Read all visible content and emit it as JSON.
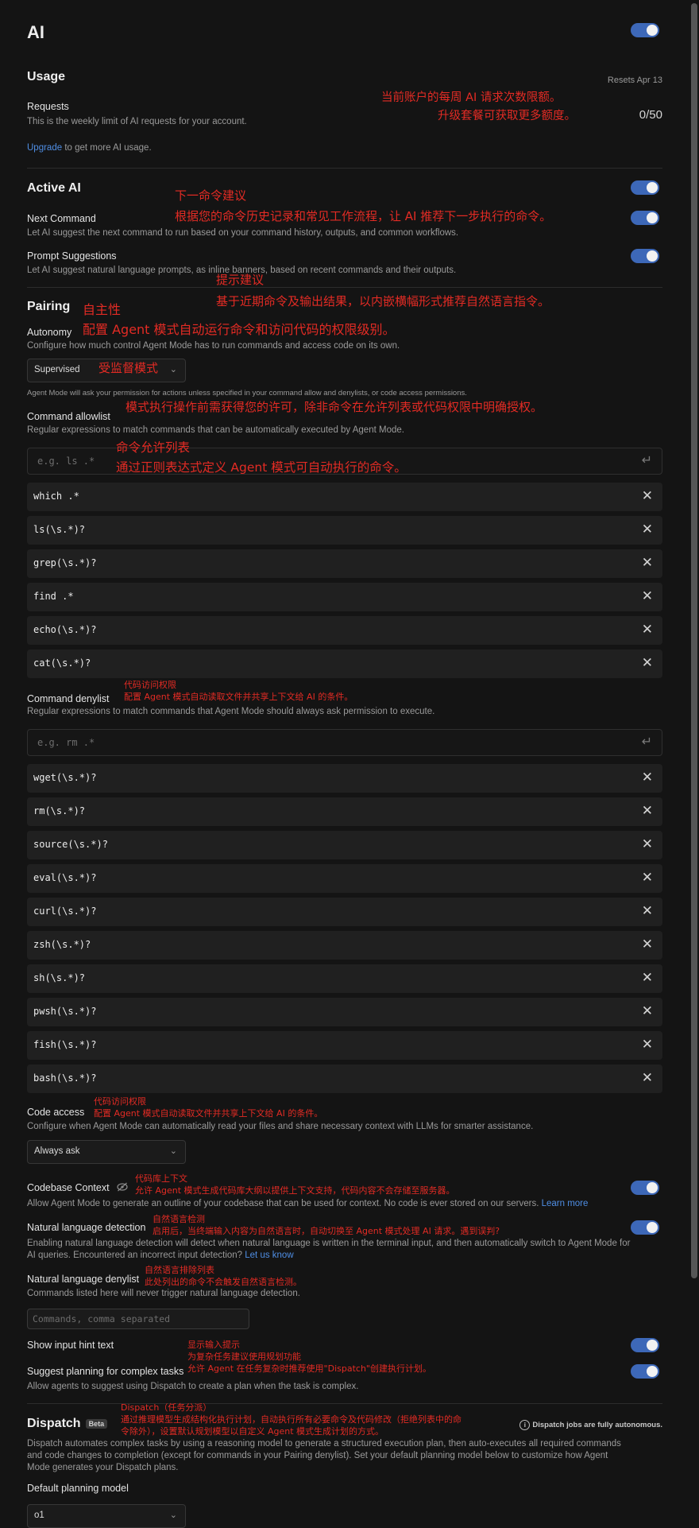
{
  "page": {
    "title": "AI"
  },
  "usage": {
    "heading": "Usage",
    "resets": "Resets Apr 13",
    "requests_label": "Requests",
    "requests_desc": "This is the weekly limit of AI requests for your account.",
    "count": "0/50",
    "upgrade_link": "Upgrade",
    "upgrade_rest": " to get more AI usage."
  },
  "active_ai": {
    "heading": "Active AI",
    "next_command_label": "Next Command",
    "next_command_desc": "Let AI suggest the next command to run based on your command history, outputs, and common workflows.",
    "prompt_suggestions_label": "Prompt Suggestions",
    "prompt_suggestions_desc": "Let AI suggest natural language prompts, as inline banners, based on recent commands and their outputs."
  },
  "pairing": {
    "heading": "Pairing",
    "autonomy_label": "Autonomy",
    "autonomy_desc": "Configure how much control Agent Mode has to run commands and access code on its own.",
    "autonomy_value": "Supervised",
    "autonomy_note": "Agent Mode will ask your permission for actions unless specified in your command allow and denylists, or code access permissions.",
    "allowlist_label": "Command allowlist",
    "allowlist_desc": "Regular expressions to match commands that can be automatically executed by Agent Mode.",
    "allowlist_placeholder": "e.g. ls .*",
    "allowlist": [
      "which .*",
      "ls(\\s.*)?",
      "grep(\\s.*)?",
      "find .*",
      "echo(\\s.*)?",
      "cat(\\s.*)?"
    ],
    "denylist_label": "Command denylist",
    "denylist_desc": "Regular expressions to match commands that Agent Mode should always ask permission to execute.",
    "denylist_placeholder": "e.g. rm .*",
    "denylist": [
      "wget(\\s.*)?",
      "rm(\\s.*)?",
      "source(\\s.*)?",
      "eval(\\s.*)?",
      "curl(\\s.*)?",
      "zsh(\\s.*)?",
      "sh(\\s.*)?",
      "pwsh(\\s.*)?",
      "fish(\\s.*)?",
      "bash(\\s.*)?"
    ],
    "code_access_label": "Code access",
    "code_access_desc": "Configure when Agent Mode can automatically read your files and share necessary context with LLMs for smarter assistance.",
    "code_access_value": "Always ask",
    "codebase_context_label": "Codebase Context",
    "codebase_context_desc": "Allow Agent Mode to generate an outline of your codebase that can be used for context. No code is ever stored on our servers.",
    "codebase_context_link": "Learn more",
    "nl_detection_label": "Natural language detection",
    "nl_detection_desc": "Enabling natural language detection will detect when natural language is written in the terminal input, and then automatically switch to Agent Mode for AI queries. Encountered an incorrect input detection?",
    "nl_detection_link": "Let us know",
    "nl_denylist_label": "Natural language denylist",
    "nl_denylist_desc": "Commands listed here will never trigger natural language detection.",
    "nl_denylist_placeholder": "Commands, comma separated",
    "show_hint_label": "Show input hint text",
    "suggest_planning_label": "Suggest planning for complex tasks",
    "suggest_planning_desc": "Allow agents to suggest using Dispatch to create a plan when the task is complex."
  },
  "dispatch": {
    "heading": "Dispatch",
    "badge": "Beta",
    "info": "Dispatch jobs are fully autonomous.",
    "desc": "Dispatch automates complex tasks by using a reasoning model to generate a structured execution plan, then auto-executes all required commands and code changes to completion (except for commands in your Pairing denylist). Set your default planning model below to customize how Agent Mode generates your Dispatch plans.",
    "model_label": "Default planning model",
    "model_value": "o1"
  },
  "annotations": {
    "usage_1": "当前账户的每周 AI 请求次数限额。",
    "usage_2": "升级套餐可获取更多额度。",
    "next_cmd_title": "下一命令建议",
    "next_cmd_body": "根据您的命令历史记录和常见工作流程，让 AI 推荐下一步执行的命令。",
    "prompt_title": "提示建议",
    "prompt_body": "基于近期命令及输出结果，以内嵌横幅形式推荐自然语言指令。",
    "autonomy_title": "自主性",
    "autonomy_body": "配置 Agent 模式自动运行命令和访问代码的权限级别。",
    "supervised": "受监督模式",
    "permission_note": "模式执行操作前需获得您的许可，除非命令在允许列表或代码权限中明确授权。",
    "allowlist_title": "命令允许列表",
    "allowlist_body": "通过正则表达式定义 Agent 模式可自动执行的命令。",
    "denylist_title": "代码访问权限",
    "denylist_body": "配置 Agent 模式自动读取文件并共享上下文给 AI 的条件。",
    "code_access_title": "代码访问权限",
    "code_access_body": "配置 Agent 模式自动读取文件并共享上下文给 AI 的条件。",
    "codebase_title": "代码库上下文",
    "codebase_body": "允许 Agent 模式生成代码库大纲以提供上下文支持，代码内容不会存储至服务器。",
    "nl_title": "自然语言检测",
    "nl_body": "启用后，当终端输入内容为自然语言时，自动切换至 Agent 模式处理 AI 请求。遇到误判?",
    "nl_deny_title": "自然语言排除列表",
    "nl_deny_body": "此处列出的命令不会触发自然语言检测。",
    "hint_title": "显示输入提示",
    "planning_title": "为复杂任务建议使用规划功能",
    "planning_body": "允许 Agent 在任务复杂时推荐使用\"Dispatch\"创建执行计划。",
    "dispatch_title": "Dispatch（任务分派）",
    "dispatch_body_1": "通过推理模型生成结构化执行计划，自动执行所有必要命令及代码修改（拒绝列表中的命",
    "dispatch_body_2": "令除外），设置默认规划模型以自定义 Agent 模式生成计划的方式。"
  }
}
